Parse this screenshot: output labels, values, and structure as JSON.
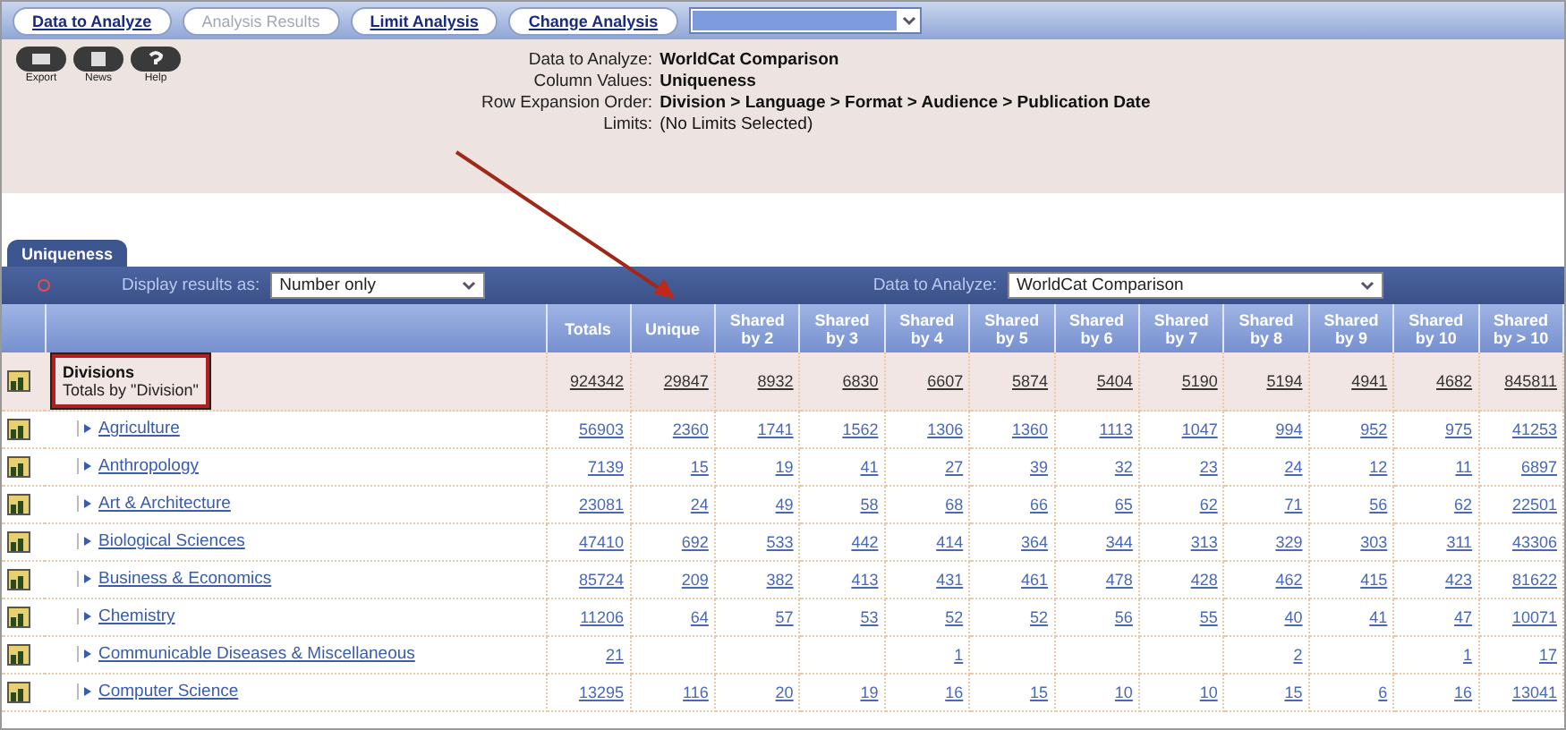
{
  "nav_tabs": [
    {
      "label": "Data to Analyze",
      "selected": false
    },
    {
      "label": "Analysis Results",
      "selected": true
    },
    {
      "label": "Limit Analysis",
      "selected": false
    },
    {
      "label": "Change Analysis",
      "selected": false
    }
  ],
  "toolbar": [
    {
      "label": "Export",
      "kind": "export"
    },
    {
      "label": "News",
      "kind": "news"
    },
    {
      "label": "Help",
      "kind": "help"
    }
  ],
  "summary": [
    {
      "label": "Data to Analyze:",
      "value": "WorldCat Comparison"
    },
    {
      "label": "Column Values:",
      "value": "Uniqueness"
    },
    {
      "label": "Row Expansion Order:",
      "value": "Division > Language > Format > Audience > Publication Date"
    },
    {
      "label": "Limits:",
      "value": "(No Limits Selected)",
      "plain": true
    }
  ],
  "panel_tab": "Uniqueness",
  "display_label": "Display results as:",
  "display_value": "Number only",
  "data_label": "Data to Analyze:",
  "data_value": "WorldCat Comparison",
  "columns": [
    "Totals",
    "Unique",
    "Shared by 2",
    "Shared by 3",
    "Shared by 4",
    "Shared by 5",
    "Shared by 6",
    "Shared by 7",
    "Shared by 8",
    "Shared by 9",
    "Shared by 10",
    "Shared by > 10"
  ],
  "total_row": {
    "title": "Divisions",
    "subtitle": "Totals by \"Division\"",
    "values": [
      "924342",
      "29847",
      "8932",
      "6830",
      "6607",
      "5874",
      "5404",
      "5190",
      "5194",
      "4941",
      "4682",
      "845811"
    ]
  },
  "rows": [
    {
      "name": "Agriculture",
      "values": [
        "56903",
        "2360",
        "1741",
        "1562",
        "1306",
        "1360",
        "1113",
        "1047",
        "994",
        "952",
        "975",
        "41253"
      ]
    },
    {
      "name": "Anthropology",
      "values": [
        "7139",
        "15",
        "19",
        "41",
        "27",
        "39",
        "32",
        "23",
        "24",
        "12",
        "11",
        "6897"
      ]
    },
    {
      "name": "Art & Architecture",
      "values": [
        "23081",
        "24",
        "49",
        "58",
        "68",
        "66",
        "65",
        "62",
        "71",
        "56",
        "62",
        "22501"
      ]
    },
    {
      "name": "Biological Sciences",
      "values": [
        "47410",
        "692",
        "533",
        "442",
        "414",
        "364",
        "344",
        "313",
        "329",
        "303",
        "311",
        "43306"
      ]
    },
    {
      "name": "Business & Economics",
      "values": [
        "85724",
        "209",
        "382",
        "413",
        "431",
        "461",
        "478",
        "428",
        "462",
        "415",
        "423",
        "81622"
      ]
    },
    {
      "name": "Chemistry",
      "values": [
        "11206",
        "64",
        "57",
        "53",
        "52",
        "52",
        "56",
        "55",
        "40",
        "41",
        "47",
        "10071"
      ]
    },
    {
      "name": "Communicable Diseases & Miscellaneous",
      "cells": {
        "col_1": "21",
        "col_5": "1",
        "col_9": "2",
        "col_11": "1",
        "col_12": "17"
      }
    },
    {
      "name": "Computer Science",
      "values": [
        "13295",
        "116",
        "20",
        "19",
        "16",
        "15",
        "10",
        "10",
        "15",
        "6",
        "16",
        "13041"
      ]
    }
  ]
}
